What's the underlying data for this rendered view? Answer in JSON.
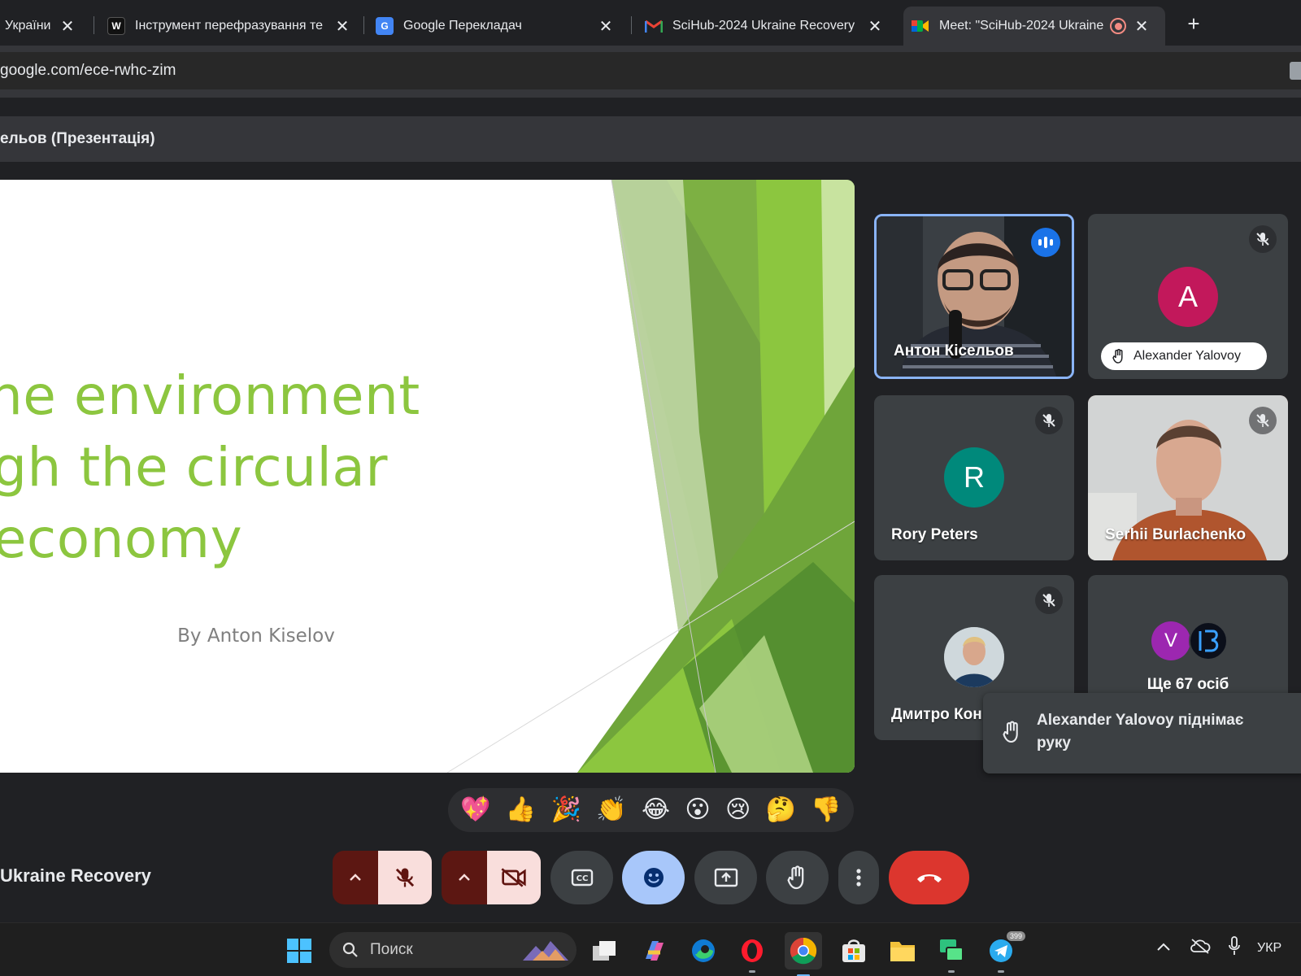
{
  "browser": {
    "tabs": [
      {
        "title": "України, ",
        "active": false
      },
      {
        "title": "Інструмент перефразування те",
        "active": false
      },
      {
        "title": "Google Перекладач",
        "active": false
      },
      {
        "title": "SciHub-2024 Ukraine Recovery",
        "active": false
      },
      {
        "title": "Meet: \"SciHub-2024 Ukraine",
        "active": true
      }
    ],
    "tab_icons": [
      "close-icon",
      "wordtune-icon",
      "google-translate-icon",
      "gmail-icon",
      "meet-icon",
      "recording-icon",
      "new-tab-icon"
    ],
    "url": "google.com/ece-rwhc-zim"
  },
  "meet": {
    "presentation_header": "ельов (Презентація)",
    "slide": {
      "title_lines": [
        "lping the environment",
        "through the circular",
        "economy"
      ],
      "author": "By Anton Kiselov",
      "accent_color": "#8cc63f"
    },
    "participants": [
      {
        "name": "Антон Кісельов",
        "video": true,
        "speaking": true
      },
      {
        "name": "Alexander Yalovoy",
        "initial": "A",
        "avatar_color": "#c2185b",
        "muted": true,
        "hand_raised": true
      },
      {
        "name": "Rory Peters",
        "initial": "R",
        "avatar_color": "#00897b",
        "muted": true
      },
      {
        "name": "Serhii Burlachenko",
        "video": true,
        "muted": true
      },
      {
        "name": "Дмитро Кон",
        "muted": true
      },
      {
        "name": "Ще 67 осіб",
        "initial": "V",
        "avatar_color": "#9c27b0"
      }
    ],
    "toast": "Alexander Yalovoy піднімає руку",
    "reactions": [
      "💖",
      "👍",
      "🎉",
      "👏",
      "😂",
      "😮",
      "😢",
      "🤔",
      "👎"
    ],
    "meeting_name": "Ukraine Recovery",
    "controls": [
      "mic-off",
      "camera-off",
      "captions",
      "reactions",
      "present-screen",
      "raise-hand",
      "more-options",
      "leave-call"
    ],
    "colors": {
      "end_call": "#dc362e",
      "off_bg": "#f9dedc",
      "active_reaction": "#a8c7fa",
      "speaking_border": "#8ab4f8"
    }
  },
  "taskbar": {
    "search_placeholder": "Поиск",
    "telegram_badge": "399",
    "language": "УКР"
  }
}
